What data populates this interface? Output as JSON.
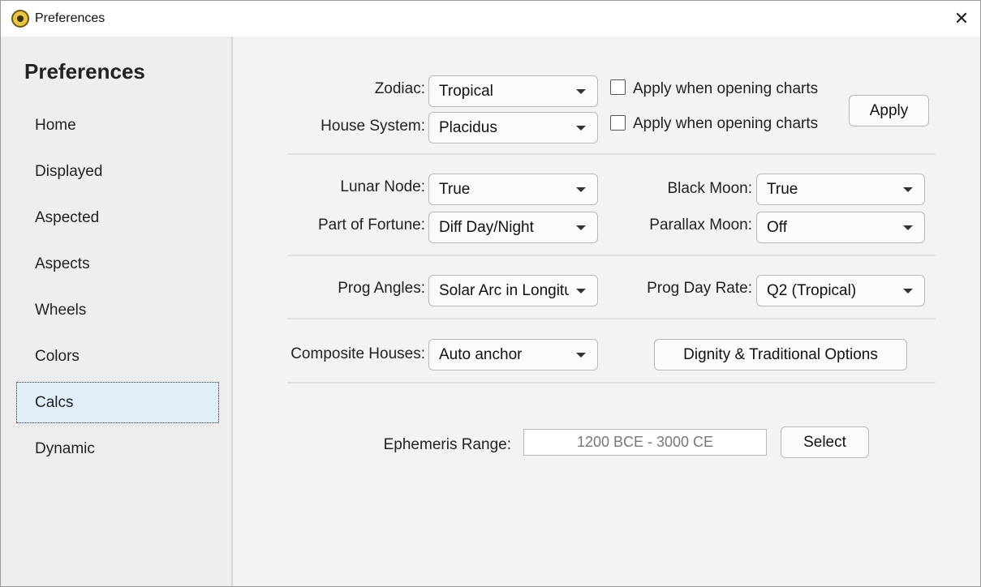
{
  "window": {
    "title": "Preferences",
    "icon": "zodiac-wheel-icon",
    "close_glyph": "✕"
  },
  "sidebar": {
    "title": "Preferences",
    "items": [
      {
        "label": "Home"
      },
      {
        "label": "Displayed"
      },
      {
        "label": "Aspected"
      },
      {
        "label": "Aspects"
      },
      {
        "label": "Wheels"
      },
      {
        "label": "Colors"
      },
      {
        "label": "Calcs",
        "active": true
      },
      {
        "label": "Dynamic"
      }
    ]
  },
  "calcs": {
    "zodiac": {
      "label": "Zodiac:",
      "value": "Tropical"
    },
    "house_system": {
      "label": "House System:",
      "value": "Placidus"
    },
    "apply_when_opening_1": {
      "label": "Apply when opening charts",
      "checked": false
    },
    "apply_when_opening_2": {
      "label": "Apply when opening charts",
      "checked": false
    },
    "apply_button": "Apply",
    "lunar_node": {
      "label": "Lunar Node:",
      "value": "True"
    },
    "part_of_fortune": {
      "label": "Part of Fortune:",
      "value": "Diff Day/Night"
    },
    "black_moon": {
      "label": "Black Moon:",
      "value": "True"
    },
    "parallax_moon": {
      "label": "Parallax Moon:",
      "value": "Off"
    },
    "prog_angles": {
      "label": "Prog Angles:",
      "value": "Solar Arc in Longitude"
    },
    "prog_day_rate": {
      "label": "Prog Day Rate:",
      "value": "Q2 (Tropical)"
    },
    "composite_houses": {
      "label": "Composite Houses:",
      "value": "Auto anchor"
    },
    "dignity_button": "Dignity & Traditional Options",
    "ephemeris_range": {
      "label": "Ephemeris Range:",
      "value": "1200 BCE - 3000 CE"
    },
    "select_button": "Select"
  }
}
